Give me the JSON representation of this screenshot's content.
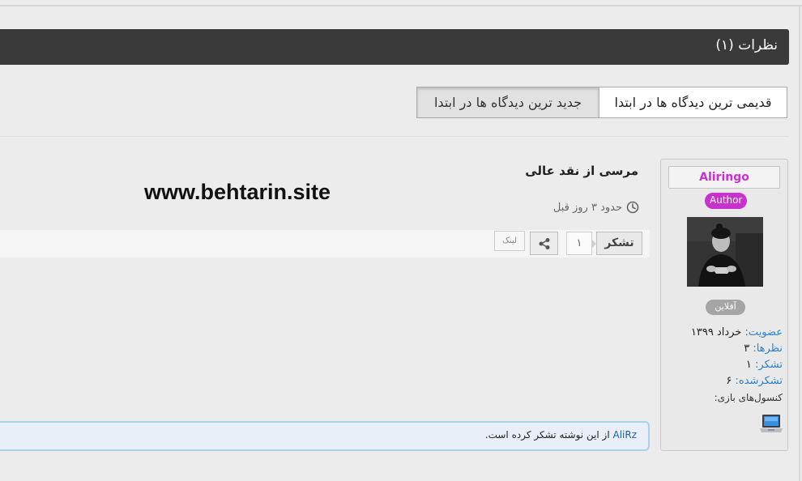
{
  "comments": {
    "header_title": "نظرات (۱)"
  },
  "sort": {
    "oldest_first": "قدیمی ترین دیدگاه ها در ابتدا",
    "newest_first": "جدید ترین دیدگاه ها در ابتدا"
  },
  "author": {
    "name": "Aliringo",
    "badge": "Author",
    "status": "آفلاین",
    "stats": {
      "membership_label": "عضویت:",
      "membership_value": "خرداد ۱۳۹۹",
      "comments_label": "نظرها:",
      "comments_value": "۳",
      "thanks_label": "تشکر:",
      "thanks_value": "۱",
      "thanked_label": "تشکرشده:",
      "thanked_value": "۶",
      "consoles_label": "کنسول‌های بازی:"
    },
    "console_icon": "laptop-icon"
  },
  "comment": {
    "text": "مرسی از نقد عالی",
    "time": "حدود ۳ روز قبل",
    "watermark": "www.behtarin.site",
    "thanks_button": "تشکر",
    "thanks_count": "۱",
    "link_label": "لینک"
  },
  "thanks_notice": {
    "user": "AliRz",
    "text": " از این نوشته تشکر کرده است."
  },
  "colors": {
    "header_bg": "#3a3a3a",
    "author_name": "#d12bd6",
    "author_badge": "#c832cc",
    "stat_label": "#2e7fc7",
    "notice_border": "#a9d1ea"
  }
}
